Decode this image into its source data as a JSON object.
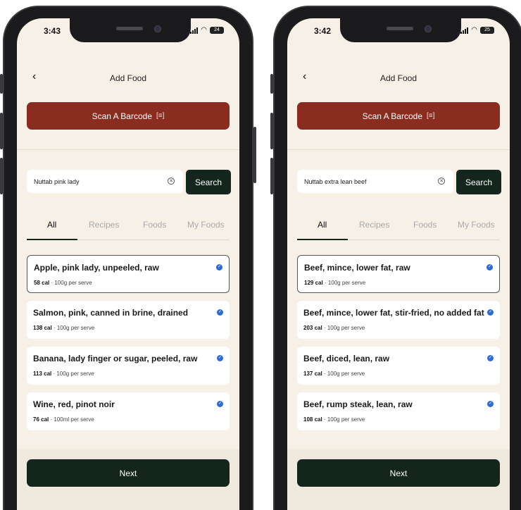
{
  "left_phone": {
    "status": {
      "time": "3:43",
      "battery": "24"
    },
    "header": {
      "title": "Add Food",
      "back_icon": "chevron-left-icon"
    },
    "scan_button": {
      "label": "Scan A Barcode",
      "icon": "barcode-scan-icon"
    },
    "search": {
      "value": "Nuttab pink lady",
      "button_label": "Search"
    },
    "tabs": [
      {
        "label": "All",
        "active": true
      },
      {
        "label": "Recipes",
        "active": false
      },
      {
        "label": "Foods",
        "active": false
      },
      {
        "label": "My Foods",
        "active": false
      }
    ],
    "results": [
      {
        "name": "Apple, pink lady, unpeeled, raw",
        "cal": "58 cal",
        "serve": " · 100g per serve",
        "selected": true
      },
      {
        "name": "Salmon, pink, canned in brine, drained",
        "cal": "138 cal",
        "serve": " · 100g per serve",
        "selected": false
      },
      {
        "name": "Banana, lady finger or sugar, peeled, raw",
        "cal": "113 cal",
        "serve": " · 100g per serve",
        "selected": false
      },
      {
        "name": "Wine, red, pinot noir",
        "cal": "76 cal",
        "serve": " · 100ml per serve",
        "selected": false
      }
    ],
    "next_label": "Next"
  },
  "right_phone": {
    "status": {
      "time": "3:42",
      "battery": "25"
    },
    "header": {
      "title": "Add Food",
      "back_icon": "chevron-left-icon"
    },
    "scan_button": {
      "label": "Scan A Barcode",
      "icon": "barcode-scan-icon"
    },
    "search": {
      "value": "Nuttab extra lean beef",
      "button_label": "Search"
    },
    "tabs": [
      {
        "label": "All",
        "active": true
      },
      {
        "label": "Recipes",
        "active": false
      },
      {
        "label": "Foods",
        "active": false
      },
      {
        "label": "My Foods",
        "active": false
      }
    ],
    "results": [
      {
        "name": "Beef, mince, lower fat, raw",
        "cal": "129 cal",
        "serve": " · 100g per serve",
        "selected": true
      },
      {
        "name": "Beef, mince, lower fat, stir-fried, no added fat",
        "cal": "203 cal",
        "serve": " · 100g per serve",
        "selected": false
      },
      {
        "name": "Beef, diced, lean, raw",
        "cal": "137 cal",
        "serve": " · 100g per serve",
        "selected": false
      },
      {
        "name": "Beef, rump steak, lean, raw",
        "cal": "108 cal",
        "serve": " · 100g per serve",
        "selected": false
      }
    ],
    "next_label": "Next"
  },
  "colors": {
    "background": "#f6f0e6",
    "scan_button": "#8b2c21",
    "primary_dark": "#13251d",
    "verified_badge": "#2f6bd8"
  }
}
